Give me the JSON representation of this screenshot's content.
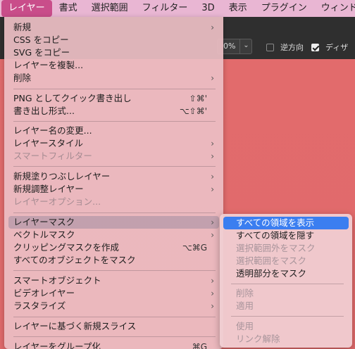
{
  "menubar": {
    "items": [
      "レイヤー",
      "書式",
      "選択範囲",
      "フィルター",
      "3D",
      "表示",
      "プラグイン",
      "ウィンドウ"
    ]
  },
  "options_bar": {
    "zoom_value": "0%",
    "reverse_label": "逆方向",
    "dither_label": "ディザ"
  },
  "layer_menu": {
    "groups": [
      [
        {
          "label": "新規",
          "shortcut": "",
          "submenu": true,
          "disabled": false
        },
        {
          "label": "CSS をコピー",
          "shortcut": "",
          "submenu": false,
          "disabled": false
        },
        {
          "label": "SVG をコピー",
          "shortcut": "",
          "submenu": false,
          "disabled": false
        },
        {
          "label": "レイヤーを複製...",
          "shortcut": "",
          "submenu": false,
          "disabled": false
        },
        {
          "label": "削除",
          "shortcut": "",
          "submenu": true,
          "disabled": false
        }
      ],
      [
        {
          "label": "PNG としてクイック書き出し",
          "shortcut": "⇧⌘'",
          "submenu": false,
          "disabled": false
        },
        {
          "label": "書き出し形式...",
          "shortcut": "⌥⇧⌘'",
          "submenu": false,
          "disabled": false
        }
      ],
      [
        {
          "label": "レイヤー名の変更...",
          "shortcut": "",
          "submenu": false,
          "disabled": false
        },
        {
          "label": "レイヤースタイル",
          "shortcut": "",
          "submenu": true,
          "disabled": false
        },
        {
          "label": "スマートフィルター",
          "shortcut": "",
          "submenu": true,
          "disabled": true
        }
      ],
      [
        {
          "label": "新規塗りつぶしレイヤー",
          "shortcut": "",
          "submenu": true,
          "disabled": false
        },
        {
          "label": "新規調整レイヤー",
          "shortcut": "",
          "submenu": true,
          "disabled": false
        },
        {
          "label": "レイヤーオプション...",
          "shortcut": "",
          "submenu": false,
          "disabled": true
        }
      ],
      [
        {
          "label": "レイヤーマスク",
          "shortcut": "",
          "submenu": true,
          "disabled": false,
          "highlighted": true
        },
        {
          "label": "ベクトルマスク",
          "shortcut": "",
          "submenu": true,
          "disabled": false
        },
        {
          "label": "クリッピングマスクを作成",
          "shortcut": "⌥⌘G",
          "submenu": false,
          "disabled": false
        },
        {
          "label": "すべてのオブジェクトをマスク",
          "shortcut": "",
          "submenu": false,
          "disabled": false
        }
      ],
      [
        {
          "label": "スマートオブジェクト",
          "shortcut": "",
          "submenu": true,
          "disabled": false
        },
        {
          "label": "ビデオレイヤー",
          "shortcut": "",
          "submenu": true,
          "disabled": false
        },
        {
          "label": "ラスタライズ",
          "shortcut": "",
          "submenu": true,
          "disabled": false
        }
      ],
      [
        {
          "label": "レイヤーに基づく新規スライス",
          "shortcut": "",
          "submenu": false,
          "disabled": false
        }
      ],
      [
        {
          "label": "レイヤーをグループ化",
          "shortcut": "⌘G",
          "submenu": false,
          "disabled": false
        }
      ]
    ]
  },
  "mask_submenu": {
    "groups": [
      [
        {
          "label": "すべての領域を表示",
          "disabled": false,
          "selected": true
        },
        {
          "label": "すべての領域を隠す",
          "disabled": false
        },
        {
          "label": "選択範囲外をマスク",
          "disabled": true
        },
        {
          "label": "選択範囲をマスク",
          "disabled": true
        },
        {
          "label": "透明部分をマスク",
          "disabled": false
        }
      ],
      [
        {
          "label": "削除",
          "disabled": true
        },
        {
          "label": "適用",
          "disabled": true
        }
      ],
      [
        {
          "label": "使用",
          "disabled": true
        },
        {
          "label": "リンク解除",
          "disabled": true
        }
      ]
    ]
  }
}
